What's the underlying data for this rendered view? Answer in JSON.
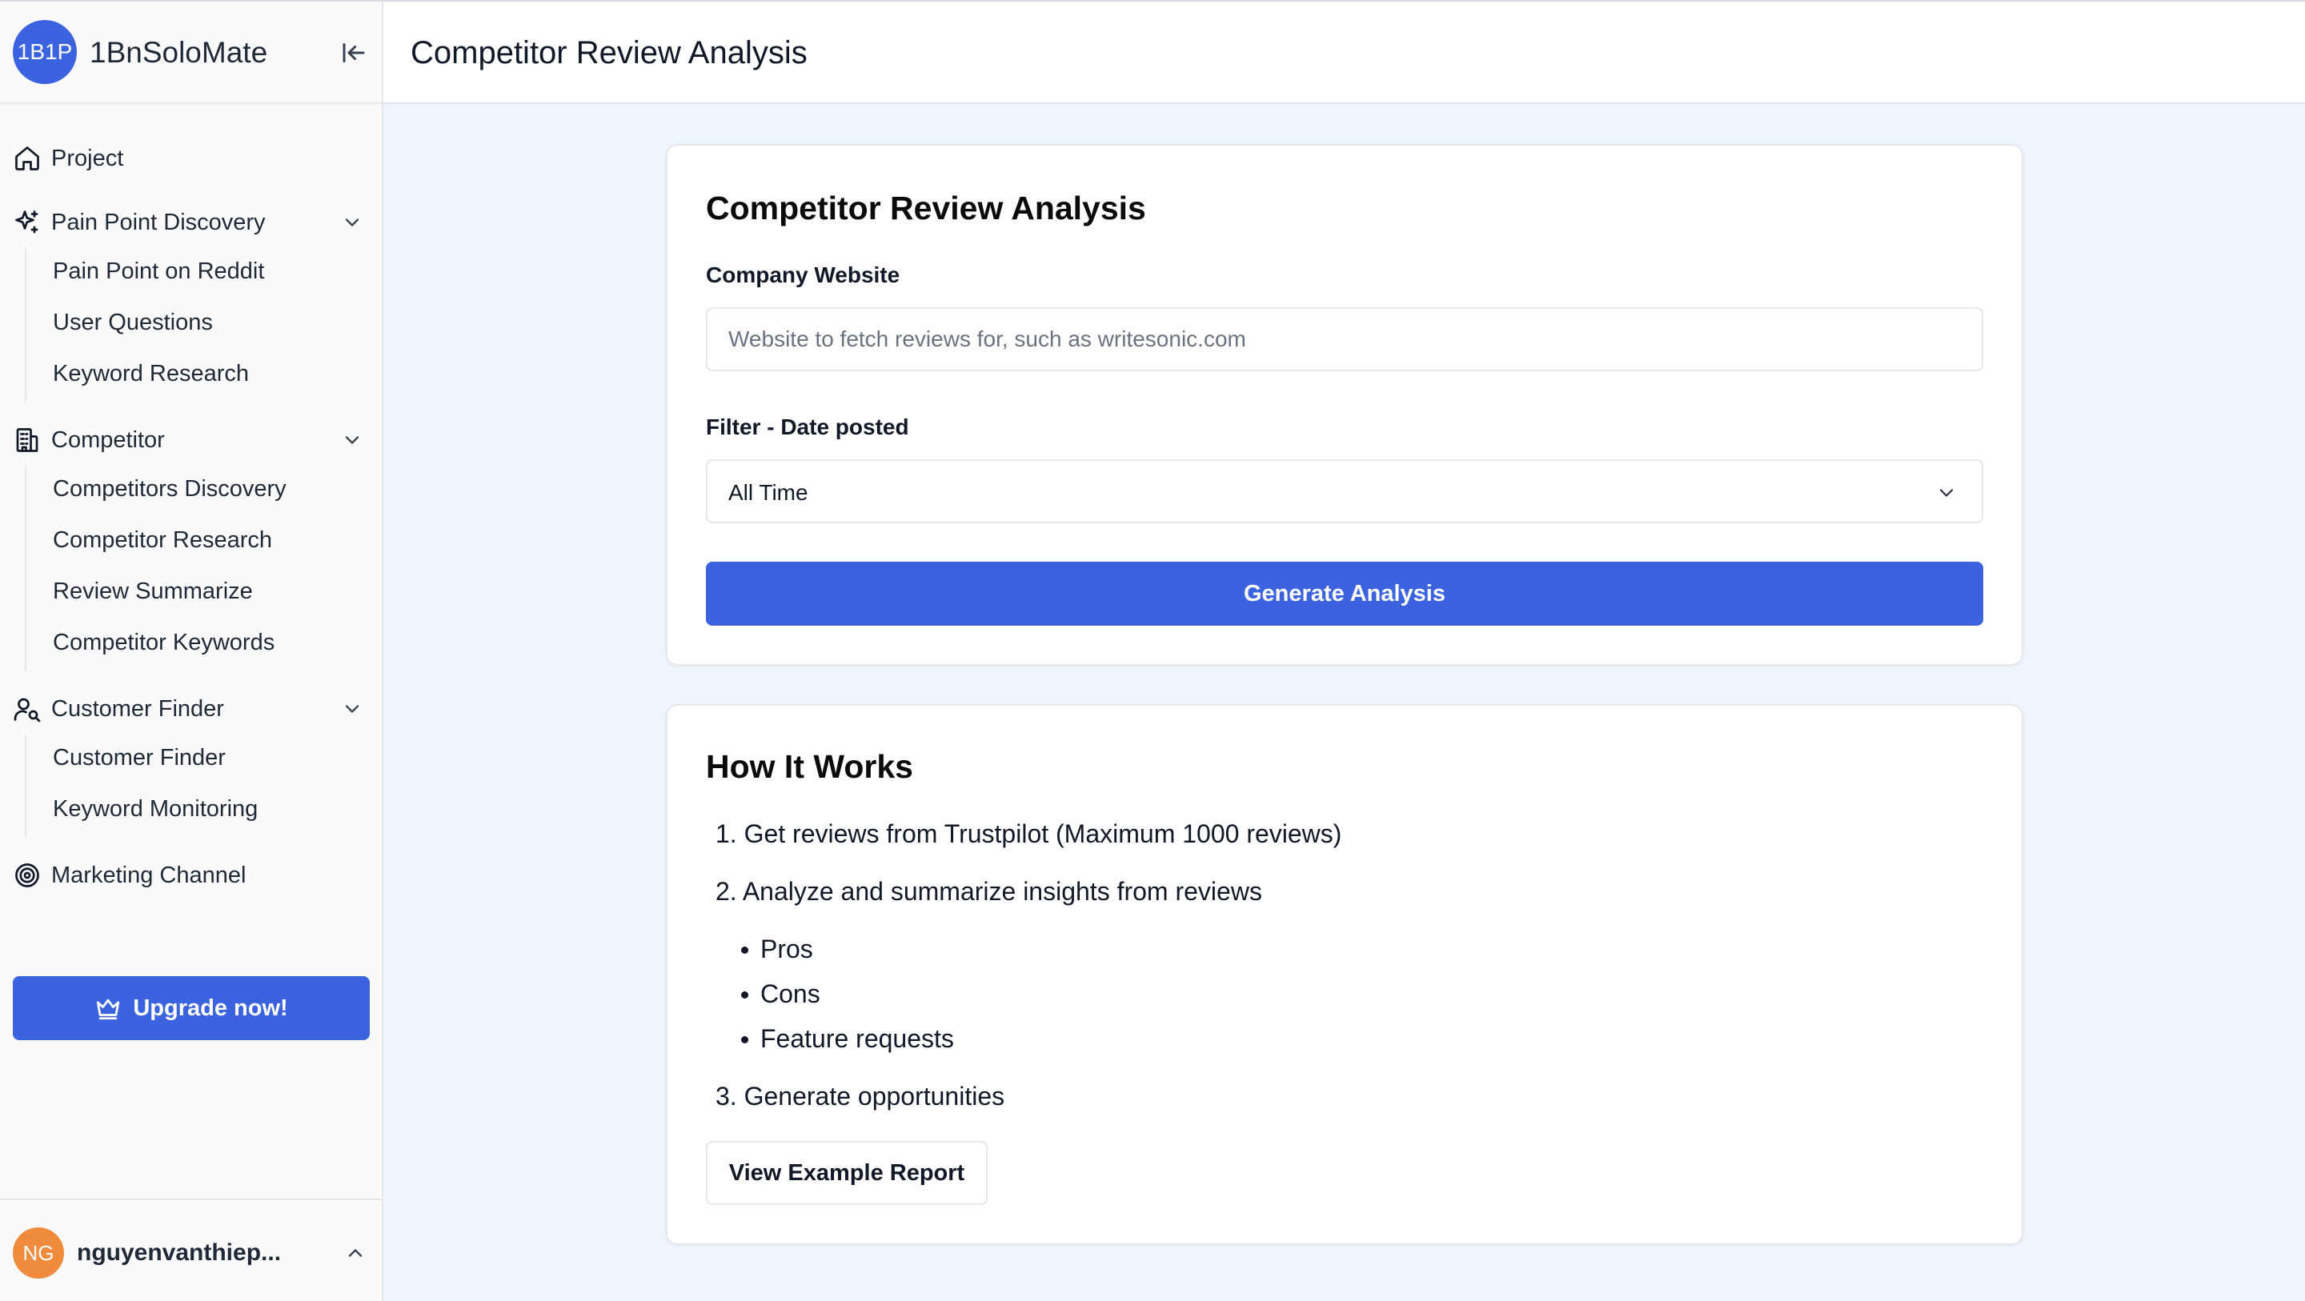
{
  "app": {
    "logo_text": "1B1P",
    "name": "1BnSoloMate"
  },
  "sidebar": {
    "project_label": "Project",
    "groups": [
      {
        "label": "Pain Point Discovery",
        "icon": "sparkles-icon",
        "items": [
          "Pain Point on Reddit",
          "User Questions",
          "Keyword Research"
        ]
      },
      {
        "label": "Competitor",
        "icon": "building-icon",
        "items": [
          "Competitors Discovery",
          "Competitor Research",
          "Review Summarize",
          "Competitor Keywords"
        ]
      },
      {
        "label": "Customer Finder",
        "icon": "user-search-icon",
        "items": [
          "Customer Finder",
          "Keyword Monitoring"
        ]
      }
    ],
    "marketing_label": "Marketing Channel",
    "upgrade_label": "Upgrade now!",
    "user": {
      "initials": "NG",
      "name": "nguyenvanthiep..."
    }
  },
  "header": {
    "title": "Competitor Review Analysis"
  },
  "form": {
    "title": "Competitor Review Analysis",
    "website_label": "Company Website",
    "website_value": "",
    "website_placeholder": "Website to fetch reviews for, such as writesonic.com",
    "filter_label": "Filter - Date posted",
    "filter_value": "All Time",
    "submit_label": "Generate Analysis"
  },
  "how": {
    "title": "How It Works",
    "steps": [
      "1. Get reviews from Trustpilot (Maximum 1000 reviews)",
      "2. Analyze and summarize insights from reviews",
      "3. Generate opportunities"
    ],
    "bullets": [
      "Pros",
      "Cons",
      "Feature requests"
    ],
    "example_label": "View Example Report"
  },
  "colors": {
    "accent": "#3b63e0",
    "page_bg": "#eff5fd",
    "avatar": "#f08a3c"
  }
}
